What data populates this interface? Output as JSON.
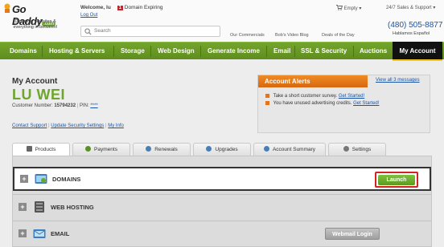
{
  "brand": {
    "logo_text": "Go Daddy",
    "logo_suffix": ".com",
    "tagline": "Domains, websites & everything in between!"
  },
  "header": {
    "welcome_label": "Welcome, lu",
    "expiring_count": "1",
    "expiring_label": "Domain Expiring",
    "logout": "Log Out",
    "search_placeholder": "Search",
    "links": [
      "Our Commercials",
      "Bob's Video Blog",
      "Deals of the Day"
    ],
    "cart_label": "Empty",
    "support_label": "24/7 Sales & Support",
    "phone": "(480) 505-8877",
    "espanol": "Hablamos Español"
  },
  "nav": {
    "items": [
      "Domains",
      "Hosting & Servers",
      "Storage",
      "Web Design",
      "Generate Income",
      "Email",
      "SSL & Security",
      "Auctions"
    ],
    "active": "My Account"
  },
  "account": {
    "title": "My Account",
    "name": "LU WEI",
    "customer_label": "Customer Number:",
    "customer_number": "15794232",
    "pin_label": "PIN:",
    "pin_value": "****",
    "links": [
      "Contact Support",
      "Update Security Settings",
      "My Info"
    ]
  },
  "alerts": {
    "title": "Account Alerts",
    "view_all": "View all 3 messages",
    "items": [
      {
        "text": "Take a short customer survey.",
        "link": "Get Started!"
      },
      {
        "text": "You have unused advertising credits.",
        "link": "Get Started!"
      }
    ]
  },
  "tabs": [
    "Products",
    "Payments",
    "Renewals",
    "Upgrades",
    "Account Summary",
    "Settings"
  ],
  "products": [
    {
      "name": "DOMAINS",
      "action": "Launch"
    },
    {
      "name": "WEB HOSTING"
    },
    {
      "name": "EMAIL",
      "action": "Webmail Login"
    }
  ],
  "colors": {
    "brand_green": "#6ea52c",
    "link_blue": "#1a55a5",
    "alert_orange": "#e27420",
    "highlight_red": "#d22222"
  }
}
